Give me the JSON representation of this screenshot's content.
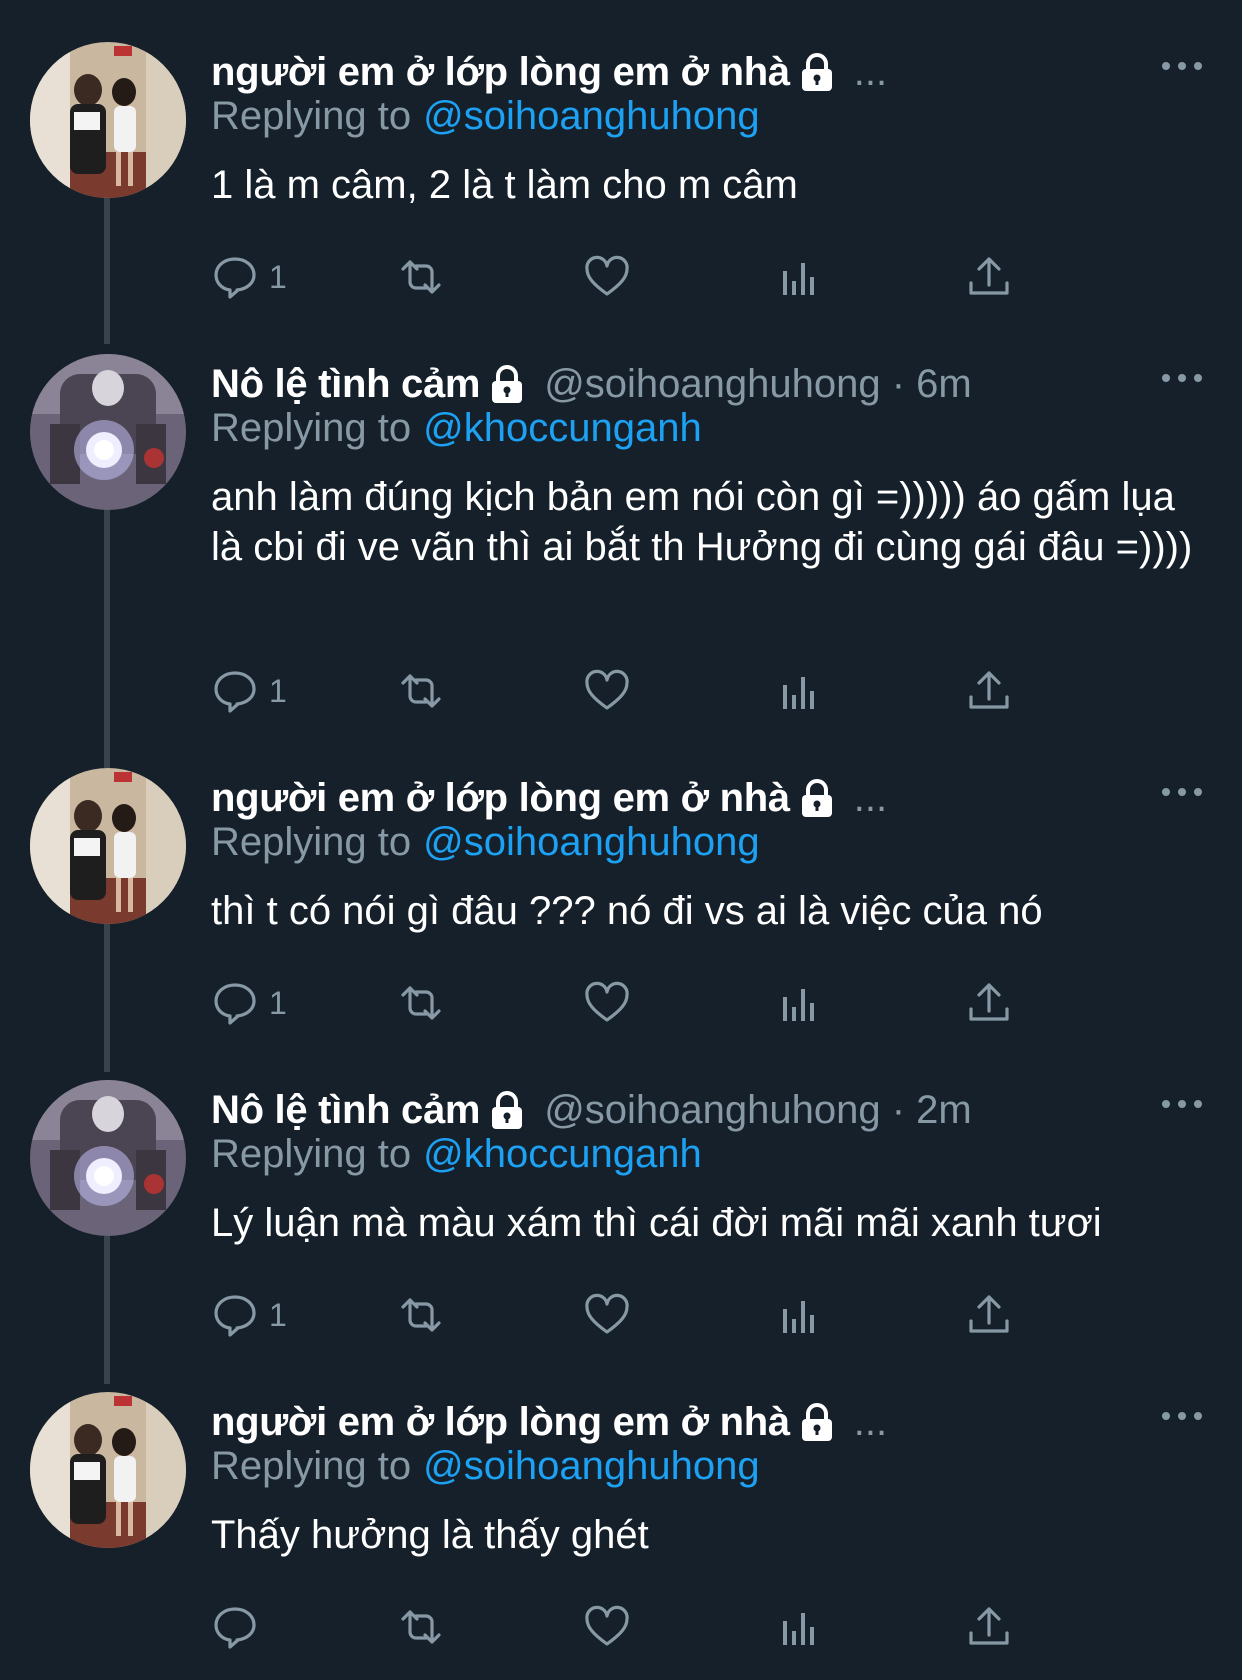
{
  "tweets": [
    {
      "name": "người em ở lớp lòng em ở nhà",
      "handle": "",
      "time": "",
      "header_suffix": "...",
      "replying_label": "Replying to",
      "replying_to": "@soihoanghuhong",
      "text": "1 là m câm, 2 là t làm cho m câm",
      "reply_count": "1",
      "avatar": "couple-photo"
    },
    {
      "name": "Nô lệ tình cảm",
      "handle": "@soihoanghuhong · 6m",
      "header_suffix": "",
      "replying_label": "Replying to",
      "replying_to": "@khoccunganh",
      "text": "anh làm đúng kịch bản em nói còn gì =))))) áo gấm lụa là cbi đi ve vãn thì ai bắt th Hưởng đi cùng gái đâu =))))",
      "reply_count": "1",
      "avatar": "bike-headlight"
    },
    {
      "name": "người em ở lớp lòng em ở nhà",
      "handle": "",
      "header_suffix": "...",
      "replying_label": "Replying to",
      "replying_to": "@soihoanghuhong",
      "text": "thì t có nói gì đâu ??? nó đi vs ai là việc của nó",
      "reply_count": "1",
      "avatar": "couple-photo"
    },
    {
      "name": "Nô lệ tình cảm",
      "handle": "@soihoanghuhong · 2m",
      "header_suffix": "",
      "replying_label": "Replying to",
      "replying_to": "@khoccunganh",
      "text": "Lý luận mà màu xám thì cái đời mãi mãi xanh tươi",
      "reply_count": "1",
      "avatar": "bike-headlight"
    },
    {
      "name": "người em ở lớp lòng em ở nhà",
      "handle": "",
      "header_suffix": "...",
      "replying_label": "Replying to",
      "replying_to": "@soihoanghuhong",
      "text": "Thấy hưởng là thấy ghét",
      "reply_count": "",
      "avatar": "couple-photo"
    }
  ],
  "icons": {
    "reply": "reply-icon",
    "retweet": "retweet-icon",
    "like": "heart-icon",
    "analytics": "analytics-icon",
    "share": "share-icon",
    "lock": "lock-icon",
    "more": "more-options-icon"
  },
  "colors": {
    "background": "#15202b",
    "text": "#ffffff",
    "secondary": "#8899a6",
    "link": "#1da1f2",
    "thread_line": "#38444d"
  }
}
